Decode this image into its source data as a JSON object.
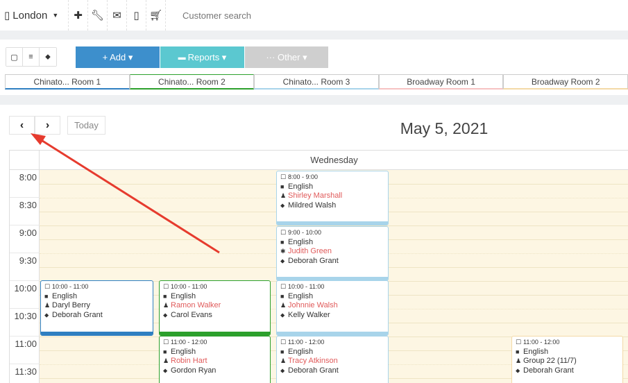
{
  "topbar": {
    "location": "London",
    "icons": [
      "plus-icon",
      "wrench-icon",
      "envelope-icon",
      "mobile-icon",
      "cart-icon"
    ],
    "search_placeholder": "Customer search"
  },
  "toolbar": {
    "add_label": "+ Add ▾",
    "reports_label": "Reports ▾",
    "other_label": "··· Other ▾"
  },
  "rooms": [
    {
      "label": "Chinato... Room 1",
      "color": "#2f7fc1"
    },
    {
      "label": "Chinato... Room 2",
      "color": "#2ca02c"
    },
    {
      "label": "Chinato... Room 3",
      "color": "#a8d4ea"
    },
    {
      "label": "Broadway Room 1",
      "color": "#f6c1c1"
    },
    {
      "label": "Broadway Room 2",
      "color": "#f3d9a6"
    }
  ],
  "nav": {
    "today_label": "Today",
    "date_title": "May 5, 2021"
  },
  "calendar": {
    "day_name": "Wednesday",
    "times": [
      "8:00",
      "8:30",
      "9:00",
      "9:30",
      "10:00",
      "10:30",
      "11:00",
      "11:30"
    ],
    "events": [
      {
        "time": "8:00 - 9:00",
        "subject": "English",
        "student": "Shirley Marshall",
        "teacher": "Mildred Walsh"
      },
      {
        "time": "9:00 - 10:00",
        "subject": "English",
        "student": "Judith Green",
        "teacher": "Deborah Grant"
      },
      {
        "time": "10:00 - 11:00",
        "subject": "English",
        "student": "Daryl Berry",
        "teacher": "Deborah Grant"
      },
      {
        "time": "10:00 - 11:00",
        "subject": "English",
        "student": "Ramon Walker",
        "teacher": "Carol Evans"
      },
      {
        "time": "10:00 - 11:00",
        "subject": "English",
        "student": "Johnnie Walsh",
        "teacher": "Kelly Walker"
      },
      {
        "time": "11:00 - 12:00",
        "subject": "English",
        "student": "Robin Hart",
        "teacher": "Gordon Ryan"
      },
      {
        "time": "11:00 - 12:00",
        "subject": "English",
        "student": "Tracy Atkinson",
        "teacher": "Deborah Grant"
      },
      {
        "time": "11:00 - 12:00",
        "subject": "English",
        "student": "Group 22 (11/7)",
        "teacher": "Deborah Grant"
      }
    ]
  }
}
